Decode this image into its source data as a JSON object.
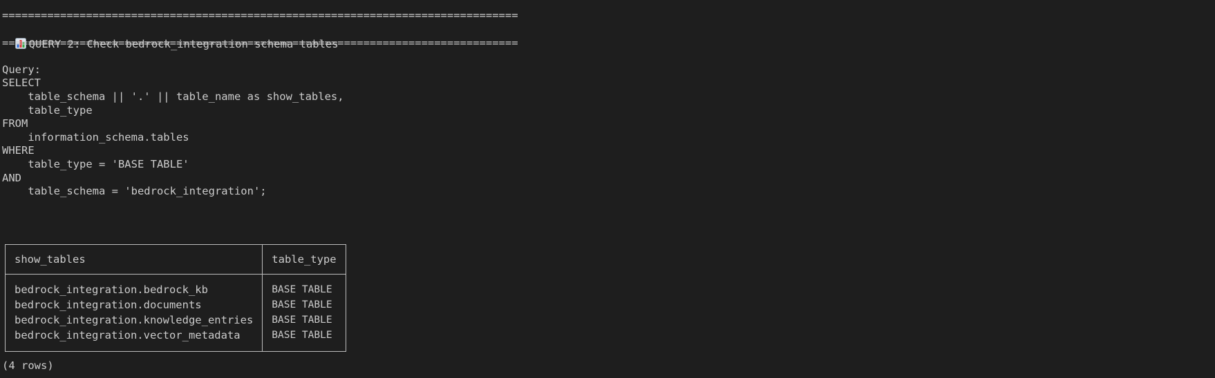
{
  "separator": "================================================================================",
  "header": {
    "icon": "bar-chart-icon",
    "title": "QUERY 2: Check bedrock_integration schema tables"
  },
  "query_label": "Query:",
  "query_lines": [
    "SELECT",
    "    table_schema || '.' || table_name as show_tables,",
    "    table_type",
    "FROM",
    "    information_schema.tables",
    "WHERE",
    "    table_type = 'BASE TABLE'",
    "AND",
    "    table_schema = 'bedrock_integration';"
  ],
  "result": {
    "columns": [
      "show_tables",
      "table_type"
    ],
    "rows": [
      [
        "bedrock_integration.bedrock_kb",
        "BASE TABLE"
      ],
      [
        "bedrock_integration.documents",
        "BASE TABLE"
      ],
      [
        "bedrock_integration.knowledge_entries",
        "BASE TABLE"
      ],
      [
        "bedrock_integration.vector_metadata",
        "BASE TABLE"
      ]
    ],
    "row_count": "(4 rows)"
  }
}
